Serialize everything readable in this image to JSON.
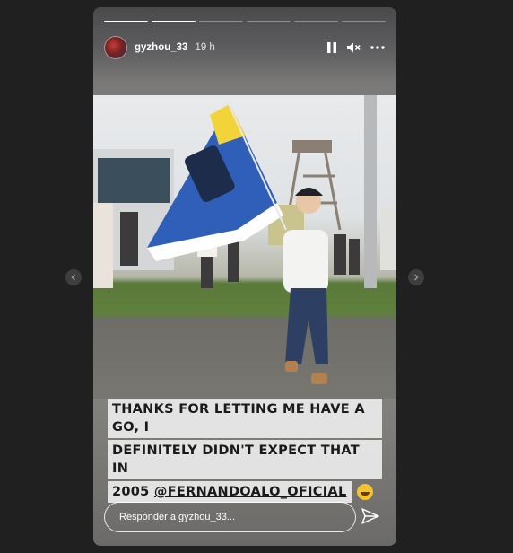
{
  "story": {
    "segments_total": 6,
    "segments_complete": 1,
    "current_segment_progress": 1.0
  },
  "header": {
    "username": "gyzhou_33",
    "time": "19 h"
  },
  "icons": {
    "pause": "pause-icon",
    "mute": "speaker-muted-icon",
    "more": "more-options-icon",
    "send": "send-icon",
    "prev": "chevron-left-icon",
    "next": "chevron-right-icon"
  },
  "caption": {
    "line1": "THANKS FOR LETTING ME HAVE A GO, I",
    "line2": "DEFINITELY DIDN'T  EXPECT THAT IN",
    "line3_prefix": "2005 ",
    "mention": "@FERNANDOALO_OFICIAL"
  },
  "reply": {
    "placeholder": "Responder a gyzhou_33..."
  },
  "colors": {
    "background": "#202020",
    "flag_blue": "#2f5fb8",
    "flag_yellow": "#f2d43a"
  }
}
